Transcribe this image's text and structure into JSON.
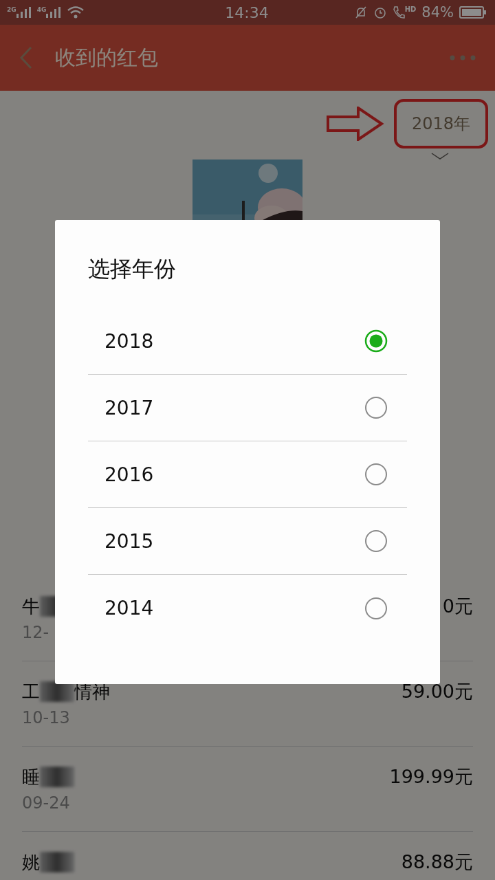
{
  "status_bar": {
    "networks": [
      "2G",
      "4G"
    ],
    "time": "14:34",
    "call_badge": "HD",
    "battery": "84%"
  },
  "header": {
    "title": "收到的红包"
  },
  "year_selector": {
    "label": "2018年"
  },
  "records": [
    {
      "name_parts": [
        "牛"
      ],
      "redacted": true,
      "date": "12-",
      "amount": "0元"
    },
    {
      "name_parts": [
        "工",
        "情神"
      ],
      "redacted": true,
      "date": "10-13",
      "amount": "59.00元"
    },
    {
      "name_parts": [
        "睡"
      ],
      "redacted": true,
      "date": "09-24",
      "amount": "199.99元"
    },
    {
      "name_parts": [
        "姚"
      ],
      "redacted": true,
      "amount": "88.88元"
    }
  ],
  "dialog": {
    "title": "选择年份",
    "options": [
      {
        "label": "2018",
        "selected": true
      },
      {
        "label": "2017",
        "selected": false
      },
      {
        "label": "2016",
        "selected": false
      },
      {
        "label": "2015",
        "selected": false
      },
      {
        "label": "2014",
        "selected": false
      }
    ]
  }
}
